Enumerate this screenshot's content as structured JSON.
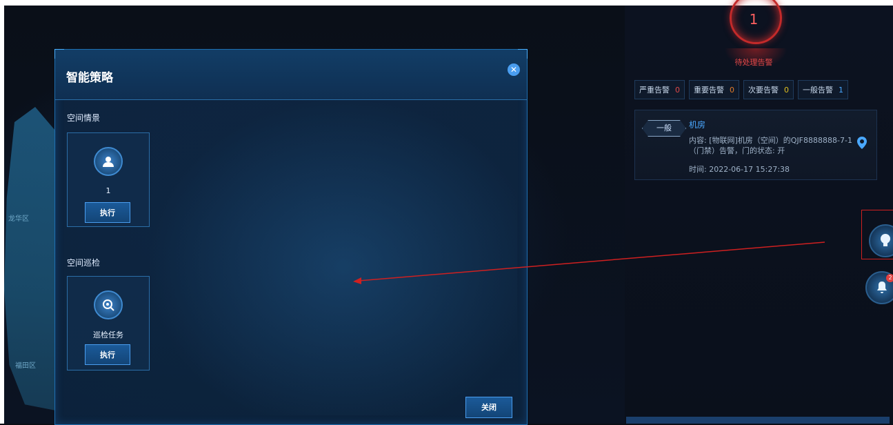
{
  "map": {
    "districts": [
      "龙华区",
      "福田区"
    ]
  },
  "alarm": {
    "pending_count": "1",
    "pending_label": "待处理告警",
    "stats": [
      {
        "label": "严重告警",
        "count": "0",
        "color": "#e04848"
      },
      {
        "label": "重要告警",
        "count": "0",
        "color": "#e07a2a"
      },
      {
        "label": "次要告警",
        "count": "0",
        "color": "#e0c020"
      },
      {
        "label": "一般告警",
        "count": "1",
        "color": "#4aa8ff"
      }
    ],
    "card": {
      "level": "一般",
      "title": "机房",
      "content": "内容: [物联网]机房（空间）的QJF8888888-7-1（门禁）告警，门的状态: 开",
      "time": "时间: 2022-06-17 15:27:38"
    }
  },
  "side_buttons": {
    "bell_badge": "2"
  },
  "modal": {
    "title": "智能策略",
    "sections": [
      {
        "label": "空间情景",
        "tile_label": "1",
        "button": "执行",
        "icon": "group-icon"
      },
      {
        "label": "空间巡检",
        "tile_label": "巡检任务",
        "button": "执行",
        "icon": "inspect-icon"
      }
    ],
    "close_label": "关闭"
  },
  "colors": {
    "accent": "#4a9ef0",
    "alarm_red": "#c42a2a",
    "annotation_red": "#d02020"
  }
}
